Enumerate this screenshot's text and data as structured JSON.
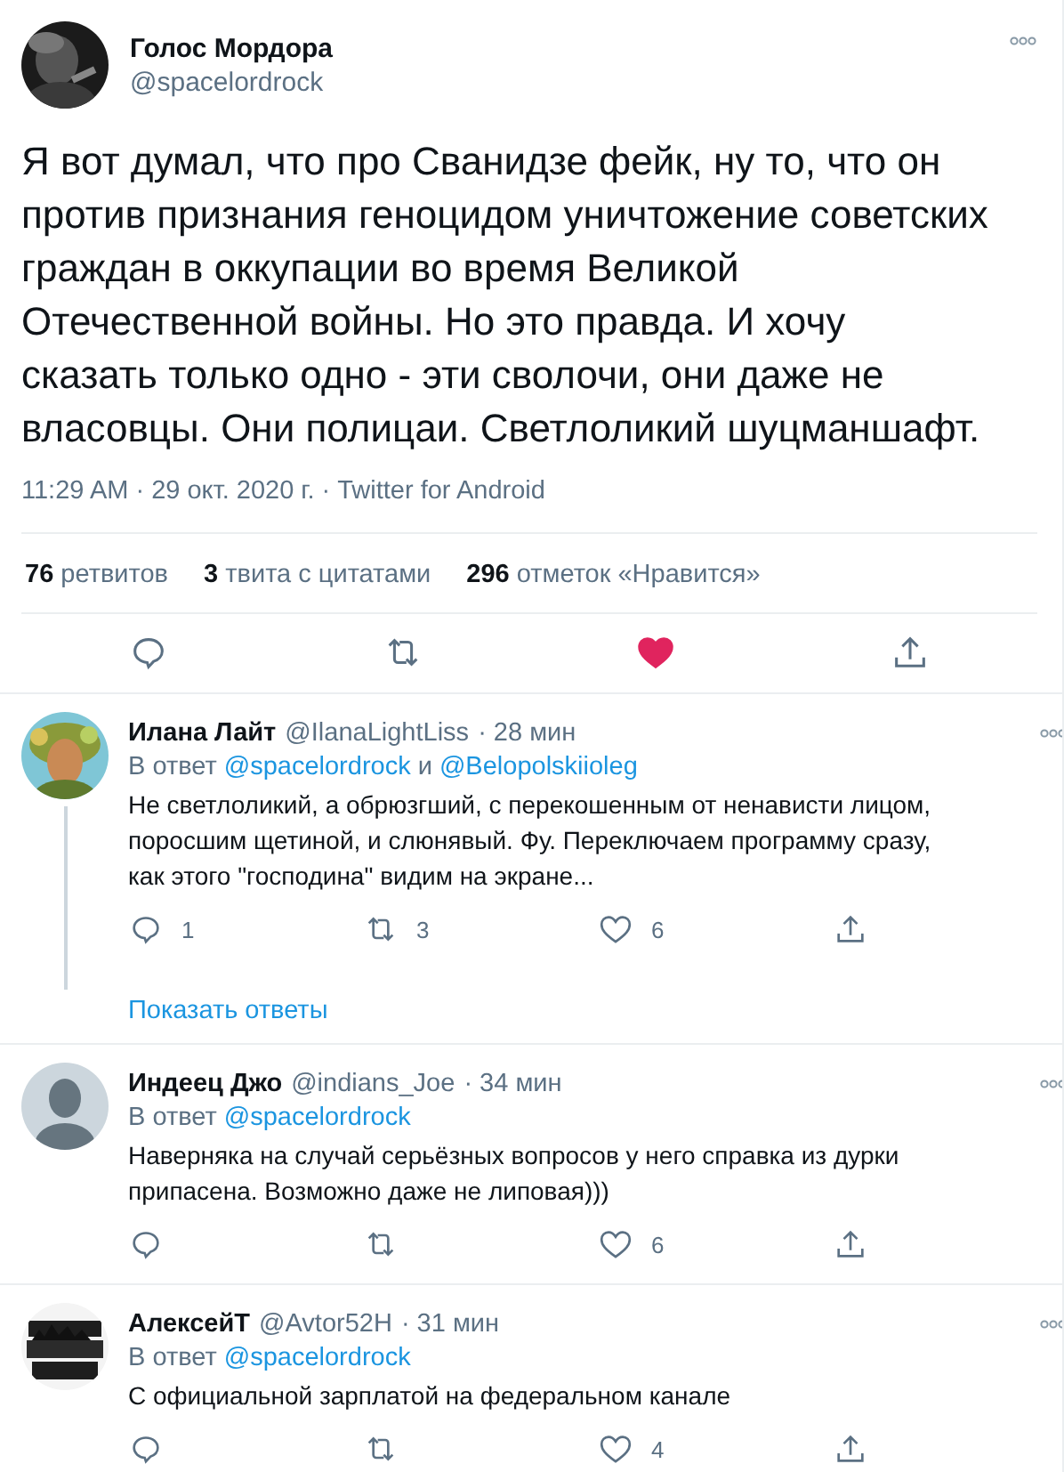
{
  "tweet": {
    "name": "Голос Мордора",
    "handle": "@spacelordrock",
    "text": "Я вот думал, что про Сванидзе фейк, ну то, что он против признания геноцидом уничтожение советских граждан в оккупации во время Великой Отечественной войны. Но это правда. И хочу сказать только одно - эти сволочи, они даже не власовцы. Они полицаи. Светлоликий шуцманшафт.",
    "meta": "11:29 AM · 29 окт. 2020 г. · Twitter for Android",
    "stats": [
      {
        "count": "76",
        "label": "ретвитов"
      },
      {
        "count": "3",
        "label": "твита с цитатами"
      },
      {
        "count": "296",
        "label": "отметок «Нравится»"
      }
    ],
    "liked": true
  },
  "replies": [
    {
      "name": "Илана Лайт",
      "handle": "@IlanaLightLiss",
      "time": "· 28 мин",
      "reply_prefix": "В ответ",
      "mentions": [
        "@spacelordrock",
        "@Belopolskiioleg"
      ],
      "joiner": "и",
      "text": "Не светлоликий, а обрюзгший, с перекошенным от ненависти лицом, поросшим щетиной, и слюнявый. Фу. Переключаем программу сразу, как этого \"господина\" видим на экране...",
      "replies_count": "1",
      "retweets": "3",
      "likes": "6",
      "liked": false,
      "thread": true,
      "show_replies": "Показать ответы"
    },
    {
      "kind": "default",
      "name": "Индеец Джо",
      "handle": "@indians_Joe",
      "time": "· 34 мин",
      "reply_prefix": "В ответ",
      "mentions": [
        "@spacelordrock"
      ],
      "text": "Наверняка на случай серьёзных вопросов у него справка из дурки припасена. Возможно даже не липовая)))",
      "likes": "6",
      "liked": false,
      "thread": false
    },
    {
      "name": "АлексейТ",
      "handle": "@Avtor52H",
      "time": "· 31 мин",
      "reply_prefix": "В ответ",
      "mentions": [
        "@spacelordrock"
      ],
      "text": "С официальной зарплатой на федеральном канале",
      "likes": "4",
      "liked": false,
      "thread": false
    }
  ]
}
